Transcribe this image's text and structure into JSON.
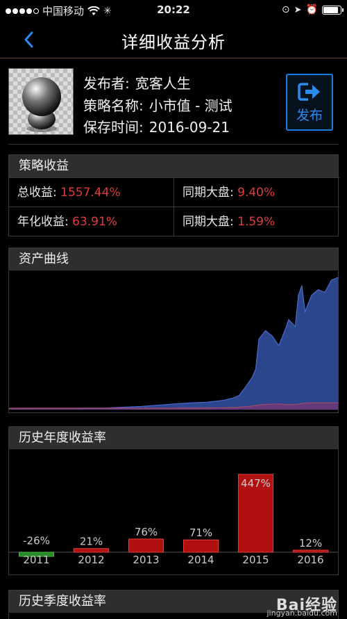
{
  "status": {
    "carrier": "中国移动",
    "time": "20:22"
  },
  "nav": {
    "title": "详细收益分析"
  },
  "profile": {
    "publisher_label": "发布者:",
    "publisher": "宽客人生",
    "strategy_label": "策略名称:",
    "strategy": "小市值 - 测试",
    "saved_label": "保存时间:",
    "saved": "2016-09-21",
    "publish_button": "发布"
  },
  "strategy_returns": {
    "title": "策略收益",
    "total_label": "总收益:",
    "total_value": "1557.44%",
    "benchmark_label_1": "同期大盘:",
    "benchmark_value_1": "9.40%",
    "annualized_label": "年化收益:",
    "annualized_value": "63.91%",
    "benchmark_label_2": "同期大盘:",
    "benchmark_value_2": "1.59%"
  },
  "asset_curve": {
    "title": "资产曲线"
  },
  "annual_returns": {
    "title": "历史年度收益率"
  },
  "quarterly_returns": {
    "title": "历史季度收益率"
  },
  "watermark": {
    "brand": "Bai经验",
    "url": "jingyan.baidu.com"
  },
  "colors": {
    "positive": "#e23a3a",
    "accent": "#2b8cf0",
    "strategy_area": "#2d4a94",
    "benchmark_area": "#6a3a78"
  },
  "chart_data": [
    {
      "type": "area",
      "title": "资产曲线",
      "x": [
        0,
        0.1,
        0.2,
        0.3,
        0.35,
        0.4,
        0.45,
        0.5,
        0.55,
        0.6,
        0.65,
        0.68,
        0.7,
        0.72,
        0.74,
        0.75,
        0.76,
        0.78,
        0.8,
        0.82,
        0.84,
        0.85,
        0.87,
        0.88,
        0.89,
        0.9,
        0.92,
        0.94,
        0.96,
        0.98,
        1.0
      ],
      "series": [
        {
          "values": [
            1.0,
            1.1,
            1.1,
            1.2,
            1.8,
            2.3,
            3.2,
            4.2,
            4.9,
            5.4,
            6.8,
            8.4,
            10.5,
            17,
            24,
            30,
            52,
            58,
            54,
            47,
            59,
            66,
            61,
            84,
            91,
            72,
            84,
            88,
            86,
            95,
            97
          ]
        },
        {
          "values": [
            1.0,
            1.0,
            1.0,
            1.0,
            1.0,
            1.0,
            1.1,
            1.1,
            1.2,
            1.3,
            1.4,
            1.6,
            1.8,
            2.2,
            2.6,
            3.0,
            3.5,
            3.8,
            4.0,
            4.2,
            3.8,
            3.6,
            3.8,
            4.0,
            4.4,
            4.8,
            5.0,
            5.0,
            5.0,
            5.0,
            5.0
          ]
        }
      ]
    },
    {
      "type": "bar",
      "title": "历史年度收益率",
      "categories": [
        "2011",
        "2012",
        "2013",
        "2014",
        "2015",
        "2016"
      ],
      "values": [
        -26,
        21,
        76,
        71,
        447,
        12
      ],
      "labels": [
        "-26%",
        "21%",
        "76%",
        "71%",
        "447%",
        "12%"
      ]
    }
  ]
}
